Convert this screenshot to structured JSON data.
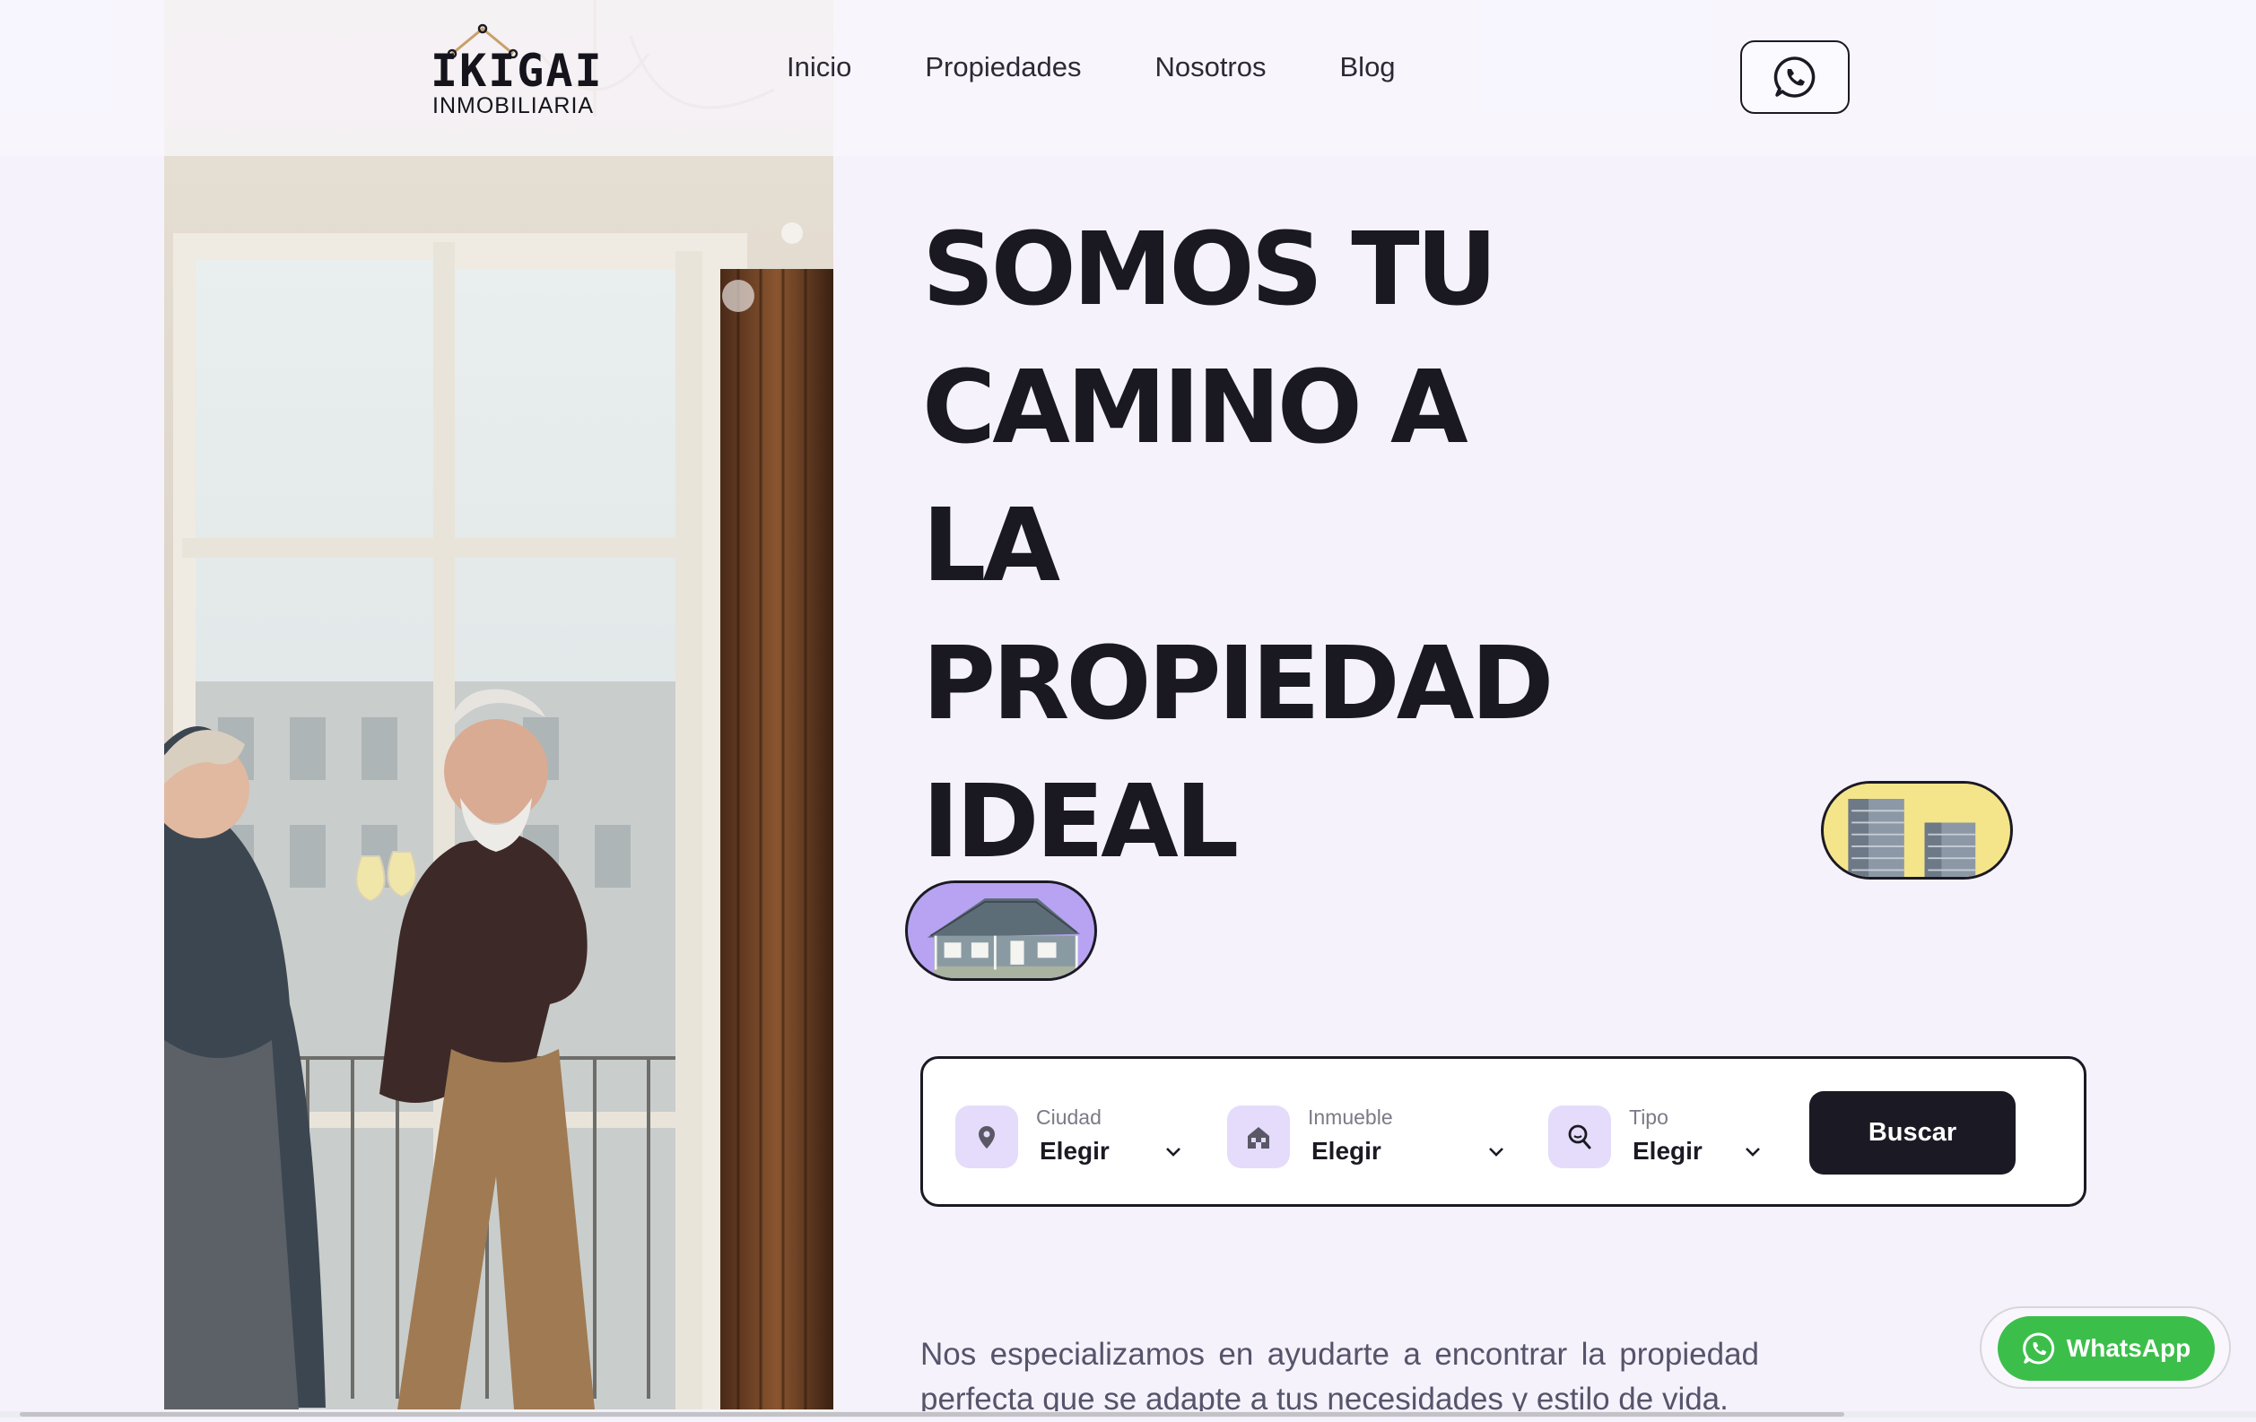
{
  "header": {
    "logo_main": "IKIGAI",
    "logo_sub": "INMOBILIARIA",
    "nav": [
      "Inicio",
      "Propiedades",
      "Nosotros",
      "Blog"
    ],
    "contact_icon": "whatsapp-icon"
  },
  "hero": {
    "headline_lines": [
      "SOMOS TU",
      "CAMINO A",
      "LA",
      "PROPIEDAD",
      "IDEAL"
    ],
    "image_subject": "couple-toasting-by-window"
  },
  "search": {
    "fields": [
      {
        "label": "Ciudad",
        "value": "Elegir",
        "icon": "location-pin-icon"
      },
      {
        "label": "Inmueble",
        "value": "Elegir",
        "icon": "house-icon"
      },
      {
        "label": "Tipo",
        "value": "Elegir",
        "icon": "search-magnifier-icon"
      }
    ],
    "button_label": "Buscar"
  },
  "description": "Nos especializamos en ayudarte a encontrar la propiedad perfecta que se adapte a tus necesidades y estilo de vida.",
  "whatsapp_float": {
    "label": "WhatsApp"
  },
  "colors": {
    "background": "#f5f2fc",
    "dark": "#1b1a24",
    "accent_lavender": "#e4dcfa",
    "whatsapp_green": "#3cbf4a",
    "pill_purple": "#b7a3f2",
    "pill_yellow": "#f5e58a"
  }
}
